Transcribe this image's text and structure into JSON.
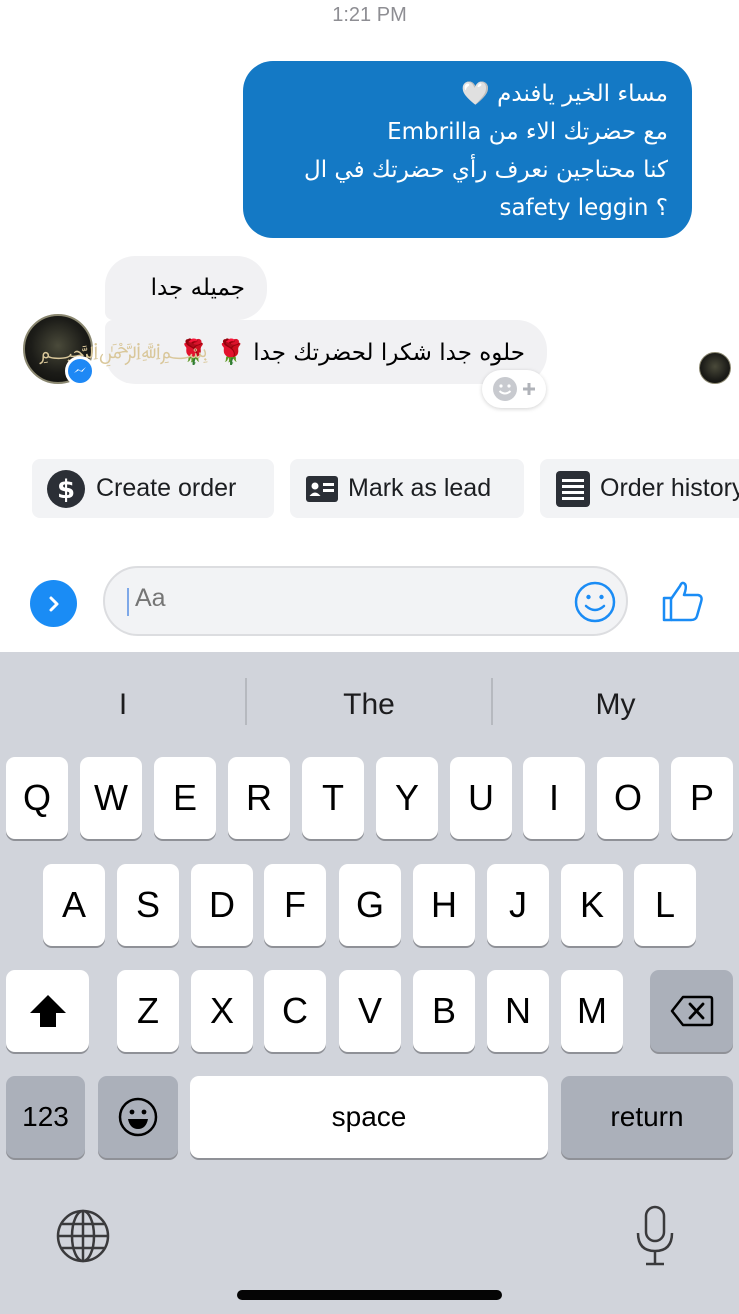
{
  "status": {
    "time": "1:21 PM"
  },
  "messages": {
    "outgoing_lines": [
      "مساء الخير يافندم 🤍",
      "مع حضرتك الاء من Embrilla",
      "كنا محتاجين نعرف رأي حضرتك في ال",
      "safety leggin ؟"
    ],
    "incoming": [
      {
        "text": "جميله جدا"
      },
      {
        "text": "حلوه جدا شكرا لحضرتك جدا",
        "emoji": "🌹 🌹"
      }
    ]
  },
  "quick_actions": [
    {
      "label": "Create order",
      "icon": "dollar-icon"
    },
    {
      "label": "Mark as lead",
      "icon": "contact-card-icon"
    },
    {
      "label": "Order history",
      "icon": "list-icon"
    }
  ],
  "composer": {
    "placeholder": "Aa"
  },
  "keyboard": {
    "suggestions": [
      "I",
      "The",
      "My"
    ],
    "row1": [
      "Q",
      "W",
      "E",
      "R",
      "T",
      "Y",
      "U",
      "I",
      "O",
      "P"
    ],
    "row2": [
      "A",
      "S",
      "D",
      "F",
      "G",
      "H",
      "J",
      "K",
      "L"
    ],
    "row3": [
      "Z",
      "X",
      "C",
      "V",
      "B",
      "N",
      "M"
    ],
    "numbers_label": "123",
    "space_label": "space",
    "return_label": "return"
  },
  "colors": {
    "accent": "#1479c5",
    "messenger_blue": "#1a8cf5",
    "keyboard_bg": "#d1d4db"
  }
}
